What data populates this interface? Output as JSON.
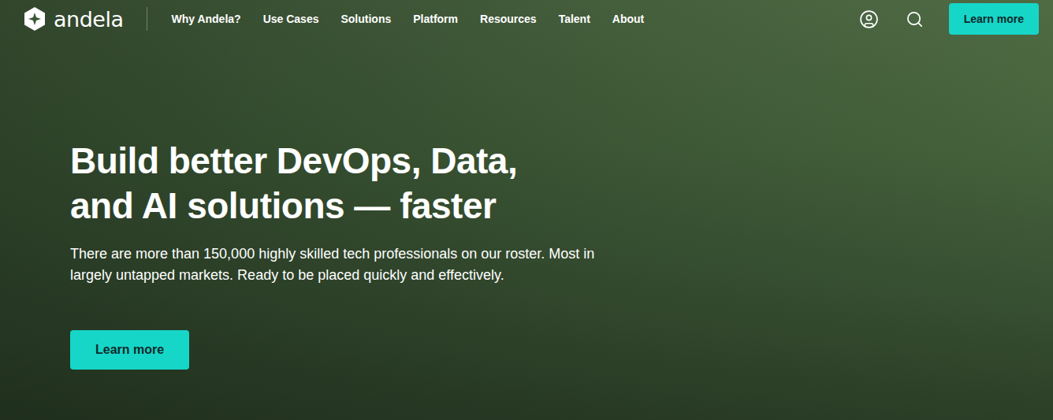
{
  "logo": {
    "text": "andela"
  },
  "nav": {
    "items": [
      {
        "label": "Why Andela?"
      },
      {
        "label": "Use Cases"
      },
      {
        "label": "Solutions"
      },
      {
        "label": "Platform"
      },
      {
        "label": "Resources"
      },
      {
        "label": "Talent"
      },
      {
        "label": "About"
      }
    ]
  },
  "header_button": {
    "label": "Learn more"
  },
  "hero": {
    "heading": [
      "Build better DevOps, Data,",
      "and AI solutions — faster"
    ],
    "description": [
      "There are more than 150,000 highly skilled tech professionals on our roster. Most in",
      "largely untapped markets. Ready to be placed quickly and effectively."
    ],
    "button": {
      "label": "Learn more"
    }
  }
}
